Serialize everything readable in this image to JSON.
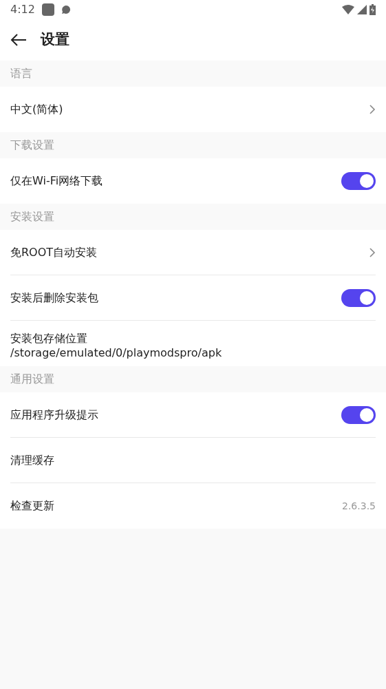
{
  "status_bar": {
    "time": "4:12"
  },
  "header": {
    "title": "设置"
  },
  "sections": [
    {
      "title": "语言",
      "items": [
        {
          "kind": "link",
          "label": "中文(简体)"
        }
      ]
    },
    {
      "title": "下载设置",
      "items": [
        {
          "kind": "toggle",
          "label": "仅在Wi-Fi网络下载",
          "on": true
        }
      ]
    },
    {
      "title": "安装设置",
      "items": [
        {
          "kind": "link",
          "label": "免ROOT自动安装"
        },
        {
          "kind": "toggle",
          "label": "安装后删除安装包",
          "on": true
        },
        {
          "kind": "detail",
          "label": "安装包存储位置",
          "detail": "/storage/emulated/0/playmodspro/apk"
        }
      ]
    },
    {
      "title": "通用设置",
      "items": [
        {
          "kind": "toggle",
          "label": "应用程序升级提示",
          "on": true
        },
        {
          "kind": "plain",
          "label": "清理缓存"
        },
        {
          "kind": "value",
          "label": "检查更新",
          "value": "2.6.3.5"
        }
      ]
    }
  ]
}
